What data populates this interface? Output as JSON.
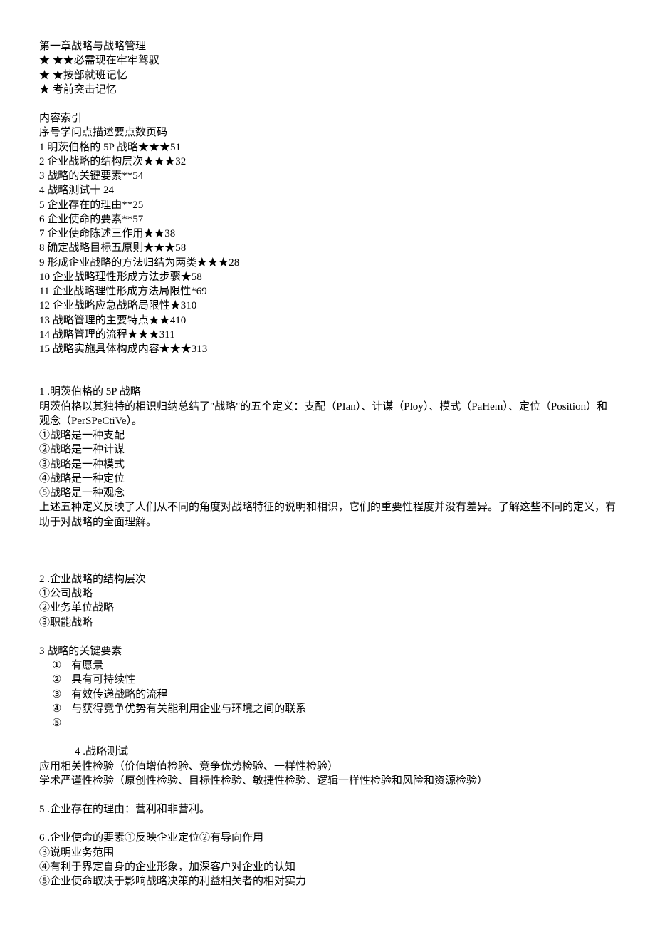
{
  "title": "第一章战略与战略管理",
  "legend": [
    "★ ★★必需现在牢牢驾驭",
    "★ ★按部就班记忆",
    "★ 考前突击记忆"
  ],
  "index_heading": "内容索引",
  "index_header_row": "序号学问点描述要点数页码",
  "index_rows": [
    "1 明茨伯格的 5P 战略★★★51",
    "2 企业战略的结构层次★★★32",
    "3 战略的关键要素**54",
    "4 战略测试十 24",
    "5 企业存在的理由**25",
    "6 企业使命的要素**57",
    "7 企业使命陈述三作用★★38",
    "8 确定战略目标五原则★★★58",
    "9 形成企业战略的方法归结为两类★★★28",
    "10 企业战略理性形成方法步骤★58",
    "11 企业战略理性形成方法局限性*69",
    "12 企业战略应急战略局限性★310",
    "13 战略管理的主要特点★★410",
    "14 战略管理的流程★★★311",
    "15 战略实施具体构成内容★★★313"
  ],
  "sec1": {
    "title": "1 .明茨伯格的 5P 战略",
    "intro": "明茨伯格以其独特的相识归纳总结了\"战略\"的五个定义：支配（PIan）、计谋（Ploy）、模式（PaHem）、定位（Position）和观念（PerSPeCtiVe）。",
    "items": [
      "①战略是一种支配",
      "②战略是一种计谋",
      "③战略是一种模式",
      "④战略是一种定位",
      "⑤战略是一种观念"
    ],
    "summary": "上述五种定义反映了人们从不同的角度对战略特征的说明和相识，它们的重要性程度并没有差异。了解这些不同的定义，有助于对战略的全面理解。"
  },
  "sec2": {
    "title": "2 .企业战略的结构层次",
    "items": [
      "①公司战略",
      "②业务单位战略",
      "③职能战略"
    ]
  },
  "sec3": {
    "title": "3 战略的关键要素",
    "circled": [
      "①",
      "②",
      "③",
      "④",
      "⑤"
    ],
    "elems": [
      "有愿景",
      "具有可持续性",
      "有效传递战略的流程",
      "与获得竞争优势有关能利用企业与环境之间的联系"
    ]
  },
  "sec4": {
    "title": "4 .战略测试",
    "l1": "应用相关性检验（价值增值检验、竞争优势检验、一样性检验）",
    "l2": "学术严谨性检验（原创性检验、目标性检验、敏捷性检验、逻辑一样性检验和风险和资源检验）"
  },
  "sec5": {
    "line": "5 .企业存在的理由：营利和非营利。"
  },
  "sec6": {
    "l1": "6 .企业使命的要素①反映企业定位②有导向作用",
    "l2": "③说明业务范围",
    "l3": "④有利于界定自身的企业形象，加深客户对企业的认知",
    "l4": "⑤企业使命取决于影响战略决策的利益相关者的相对实力"
  }
}
